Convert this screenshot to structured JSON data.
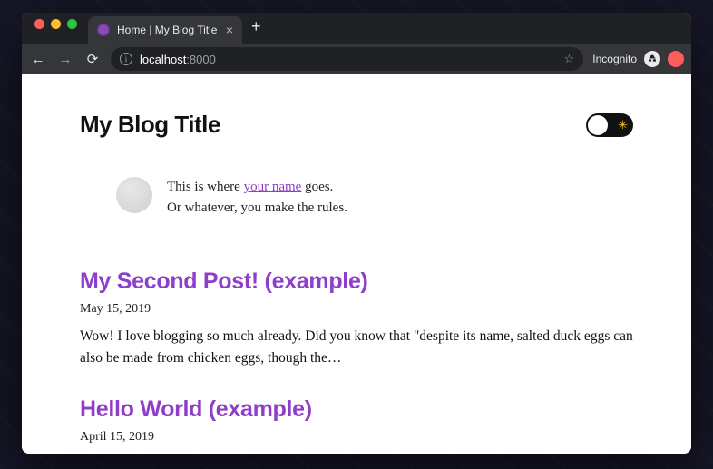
{
  "browser": {
    "tab_title": "Home | My Blog Title",
    "url_host": "localhost",
    "url_port": ":8000",
    "incognito_label": "Incognito"
  },
  "site": {
    "title": "My Blog Title"
  },
  "bio": {
    "prefix": "This is where ",
    "link_text": "your name",
    "suffix": " goes.",
    "line2": "Or whatever, you make the rules."
  },
  "posts": [
    {
      "title": "My Second Post! (example)",
      "date": "May 15, 2019",
      "excerpt": "Wow! I love blogging so much already. Did you know that \"despite its name, salted duck eggs can also be made from chicken eggs, though the…"
    },
    {
      "title": "Hello World (example)",
      "date": "April 15, 2019",
      "excerpt": ""
    }
  ],
  "colors": {
    "accent": "#8e3fc9"
  }
}
